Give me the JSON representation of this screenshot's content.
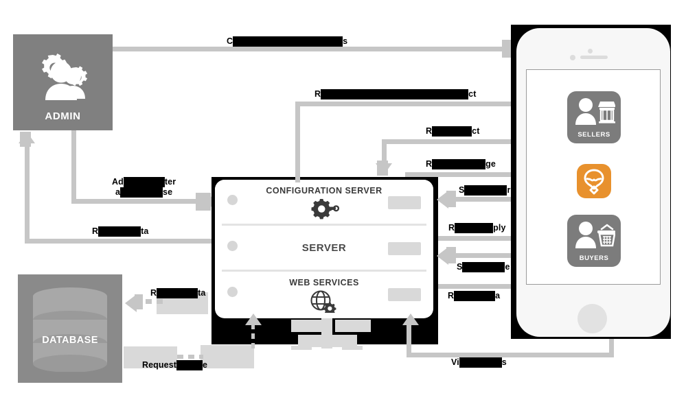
{
  "diagram": {
    "title": "Marketplace system architecture",
    "colors": {
      "node_grey": "#808080",
      "connector_grey": "#c6c6c6",
      "app_accent": "#e8912d",
      "card_grey": "#7c7c7c",
      "redaction": "#000000"
    }
  },
  "nodes": {
    "admin": {
      "label": "ADMIN",
      "icon": "admin-users-gear-icon"
    },
    "database": {
      "label": "DATABASE",
      "icon": "database-cylinder-icon"
    },
    "server_stack": {
      "rows": [
        {
          "label": "CONFIGURATION SERVER",
          "icon": "gear-wrench-icon",
          "status": "",
          "chip": ""
        },
        {
          "label": "SERVER",
          "icon": "",
          "status": "",
          "chip": ""
        },
        {
          "label": "WEB SERVICES",
          "icon": "globe-gear-icon",
          "status": "",
          "chip": ""
        }
      ]
    },
    "phone": {
      "sellers": {
        "label": "SELLERS",
        "icon": "seller-person-stall-icon"
      },
      "buyers": {
        "label": "BUYERS",
        "icon": "buyer-person-basket-icon"
      },
      "app_icon": {
        "label": "",
        "icon": "marketplace-app-icon"
      }
    }
  },
  "connectors": [
    {
      "id": "admin-to-phone",
      "visible_prefix": "C",
      "visible_suffix": "s",
      "redacted": true
    },
    {
      "id": "server-to-sellers",
      "visible_prefix": "R",
      "visible_suffix": "ct",
      "redacted": true
    },
    {
      "id": "sellers-request",
      "visible_prefix": "R",
      "visible_suffix": "ct",
      "redacted": true
    },
    {
      "id": "sellers-manage",
      "visible_prefix": "R",
      "visible_suffix": "ge",
      "redacted": true
    },
    {
      "id": "sellers-send",
      "visible_prefix": "S",
      "visible_suffix": "r",
      "redacted": true
    },
    {
      "id": "server-to-buyers",
      "visible_prefix": "R",
      "visible_suffix": "ply",
      "redacted": true
    },
    {
      "id": "buyers-send",
      "visible_prefix": "S",
      "visible_suffix": "e",
      "redacted": true
    },
    {
      "id": "buyers-receive",
      "visible_prefix": "R",
      "visible_suffix": "a",
      "redacted": true
    },
    {
      "id": "admin-add",
      "visible_prefix": "Ad",
      "visible_mid": "ter",
      "visible_suffix": "se",
      "line2": true,
      "redacted": true
    },
    {
      "id": "admin-receive",
      "visible_prefix": "R",
      "visible_suffix": "ta",
      "redacted": true
    },
    {
      "id": "db-receive",
      "visible_prefix": "R",
      "visible_suffix": "ta",
      "redacted": true
    },
    {
      "id": "db-request",
      "visible_prefix": "Request",
      "visible_suffix": "e",
      "redacted": true
    },
    {
      "id": "view-products",
      "visible_prefix": "Vi",
      "visible_suffix": "s",
      "redacted": true
    }
  ],
  "labels": {
    "admin_to_phone": {
      "pre": "C",
      "bar": 160,
      "post": "s"
    },
    "server_to_sellers": {
      "pre": "R",
      "bar": 215,
      "post": "ct"
    },
    "sellers_request": {
      "pre": "R",
      "bar": 58,
      "post": "ct"
    },
    "sellers_manage": {
      "pre": "R",
      "bar": 78,
      "post": "ge"
    },
    "sellers_send": {
      "pre": "S",
      "bar": 62,
      "post": "r"
    },
    "server_to_buyers": {
      "pre": "R",
      "bar": 56,
      "post": "ply"
    },
    "buyers_send": {
      "pre": "S",
      "bar": 62,
      "post": "e"
    },
    "buyers_receive": {
      "pre": "R",
      "bar": 60,
      "post": "a"
    },
    "admin_add_l1": {
      "pre": "Ad",
      "bar": 60,
      "post": "ter"
    },
    "admin_add_l2": {
      "pre": "a",
      "bar": 62,
      "post": "se"
    },
    "admin_receive": {
      "pre": "R",
      "bar": 62,
      "post": "ta"
    },
    "db_receive": {
      "pre": "R",
      "bar": 60,
      "post": "ta"
    },
    "db_request": {
      "pre": "Request",
      "bar": 38,
      "post": "e"
    },
    "view_products": {
      "pre": "Vi",
      "bar": 62,
      "post": "s"
    }
  }
}
